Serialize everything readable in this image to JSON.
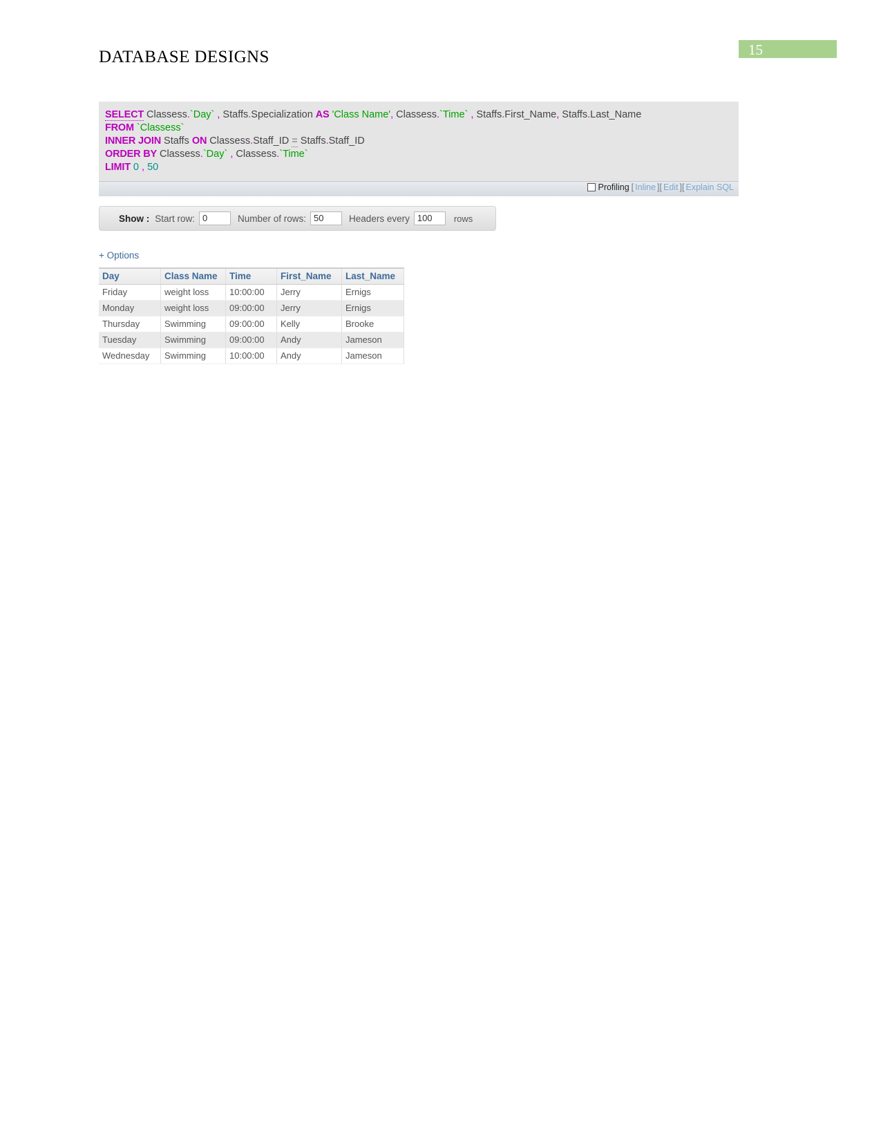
{
  "document": {
    "title": "DATABASE DESIGNS",
    "page_number": "15",
    "badge_color": "#a9d18e"
  },
  "sql_box": {
    "lines": [
      [
        {
          "t": "SELECT",
          "c": "kw-underline"
        },
        {
          "t": " ",
          "c": "plain"
        },
        {
          "t": "Classess",
          "c": "id"
        },
        {
          "t": ".",
          "c": "punc"
        },
        {
          "t": "`Day`",
          "c": "quoted"
        },
        {
          "t": " ",
          "c": "plain"
        },
        {
          "t": ",",
          "c": "punc"
        },
        {
          "t": " Staffs",
          "c": "id"
        },
        {
          "t": ".",
          "c": "punc"
        },
        {
          "t": "Specialization ",
          "c": "id"
        },
        {
          "t": "AS",
          "c": "kw"
        },
        {
          "t": " ",
          "c": "plain"
        },
        {
          "t": "'Class Name'",
          "c": "quoted"
        },
        {
          "t": ",",
          "c": "punc"
        },
        {
          "t": " Classess",
          "c": "id"
        },
        {
          "t": ".",
          "c": "punc"
        },
        {
          "t": "`Time`",
          "c": "quoted"
        },
        {
          "t": " ",
          "c": "plain"
        },
        {
          "t": ",",
          "c": "punc"
        },
        {
          "t": " Staffs",
          "c": "id"
        },
        {
          "t": ".",
          "c": "punc"
        },
        {
          "t": "First_Name",
          "c": "id"
        },
        {
          "t": ",",
          "c": "punc"
        },
        {
          "t": " Staffs",
          "c": "id"
        },
        {
          "t": ".",
          "c": "punc"
        },
        {
          "t": "Last_Name",
          "c": "id"
        }
      ],
      [
        {
          "t": "FROM",
          "c": "kw"
        },
        {
          "t": " ",
          "c": "plain"
        },
        {
          "t": "`Classess`",
          "c": "quoted"
        }
      ],
      [
        {
          "t": "INNER JOIN",
          "c": "kw"
        },
        {
          "t": " Staffs ",
          "c": "id"
        },
        {
          "t": "ON",
          "c": "kw"
        },
        {
          "t": " Classess",
          "c": "id"
        },
        {
          "t": ".",
          "c": "punc"
        },
        {
          "t": "Staff_ID ",
          "c": "id"
        },
        {
          "t": "=",
          "c": "eq"
        },
        {
          "t": " Staffs",
          "c": "id"
        },
        {
          "t": ".",
          "c": "punc"
        },
        {
          "t": "Staff_ID",
          "c": "id"
        }
      ],
      [
        {
          "t": "ORDER BY",
          "c": "kw"
        },
        {
          "t": " Classess",
          "c": "id"
        },
        {
          "t": ".",
          "c": "punc"
        },
        {
          "t": "`Day`",
          "c": "quoted"
        },
        {
          "t": " ",
          "c": "plain"
        },
        {
          "t": ",",
          "c": "punc"
        },
        {
          "t": " Classess",
          "c": "id"
        },
        {
          "t": ".",
          "c": "punc"
        },
        {
          "t": "`Time`",
          "c": "quoted"
        }
      ],
      [
        {
          "t": "LIMIT",
          "c": "kw"
        },
        {
          "t": " ",
          "c": "plain"
        },
        {
          "t": "0",
          "c": "num"
        },
        {
          "t": " ",
          "c": "plain"
        },
        {
          "t": ",",
          "c": "punc"
        },
        {
          "t": " ",
          "c": "plain"
        },
        {
          "t": "50",
          "c": "num"
        }
      ]
    ],
    "toolbar": {
      "profiling_label": "Profiling",
      "profiling_checked": false,
      "open_bracket": "[",
      "close_bracket": "]",
      "inline_label": "Inline",
      "edit_label": "Edit",
      "explain_label": "Explain SQL"
    }
  },
  "show_bar": {
    "show_label": "Show :",
    "start_row_label": "Start row:",
    "start_row_value": "0",
    "number_of_rows_label": "Number of rows:",
    "number_of_rows_value": "50",
    "headers_every_label": "Headers every",
    "headers_every_value": "100",
    "rows_label": "rows"
  },
  "options_link": "+ Options",
  "results_table": {
    "columns": [
      "Day",
      "Class Name",
      "Time",
      "First_Name",
      "Last_Name"
    ],
    "rows": [
      [
        "Friday",
        "weight loss",
        "10:00:00",
        "Jerry",
        "Ernigs"
      ],
      [
        "Monday",
        "weight loss",
        "09:00:00",
        "Jerry",
        "Ernigs"
      ],
      [
        "Thursday",
        "Swimming",
        "09:00:00",
        "Kelly",
        "Brooke"
      ],
      [
        "Tuesday",
        "Swimming",
        "09:00:00",
        "Andy",
        "Jameson"
      ],
      [
        "Wednesday",
        "Swimming",
        "10:00:00",
        "Andy",
        "Jameson"
      ]
    ]
  }
}
